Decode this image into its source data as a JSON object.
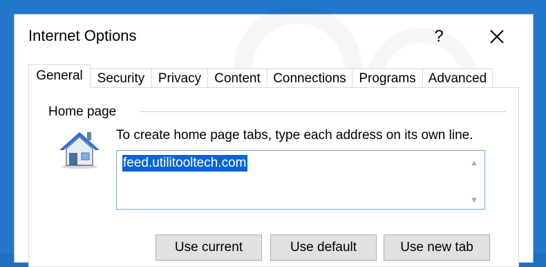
{
  "window": {
    "title": "Internet Options",
    "help_label": "?"
  },
  "tabs": [
    {
      "label": "General",
      "active": true
    },
    {
      "label": "Security",
      "active": false
    },
    {
      "label": "Privacy",
      "active": false
    },
    {
      "label": "Content",
      "active": false
    },
    {
      "label": "Connections",
      "active": false
    },
    {
      "label": "Programs",
      "active": false
    },
    {
      "label": "Advanced",
      "active": false
    }
  ],
  "home_page": {
    "group_label": "Home page",
    "instruction": "To create home page tabs, type each address on its own line.",
    "address": "feed.utilitooltech.com",
    "buttons": {
      "use_current": "Use current",
      "use_default": "Use default",
      "use_new_tab": "Use new tab"
    }
  },
  "colors": {
    "frame_blue": "#2377cc",
    "selection_blue": "#0a64d6",
    "button_gray": "#e1e1e1",
    "house_blue": "#2f6fd6"
  }
}
